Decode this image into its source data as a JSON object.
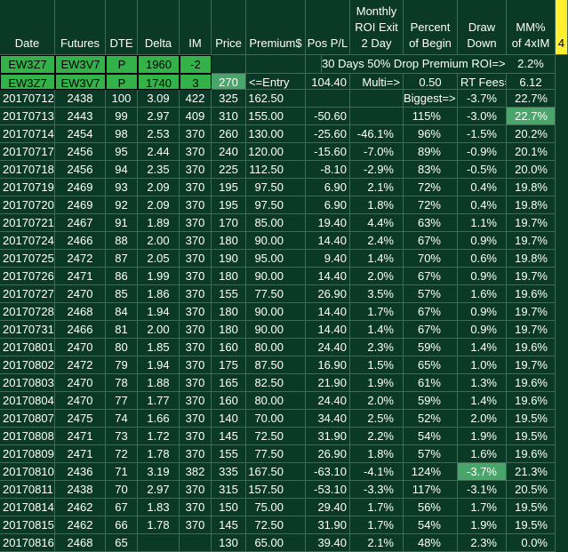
{
  "sheet": {
    "headers": {
      "date": "Date",
      "futures": "Futures",
      "dte": "DTE",
      "delta": "Delta",
      "im": "IM",
      "price": "Price",
      "premium": "Premium$",
      "pospl": "Pos P/L",
      "roi_lines": [
        "Monthly",
        "ROI Exit",
        "2 Day"
      ],
      "pct_lines": [
        "Percent",
        "of Begin"
      ],
      "draw_lines": [
        "Draw",
        "Down"
      ],
      "mm_lines": [
        "MM%",
        "of 4xIM"
      ],
      "marker": "4"
    },
    "colors": {
      "background": "#0a3a26",
      "grid": "#3e6a56",
      "input_green": "#33b24a",
      "highlight": "#4aa56a",
      "marker_yellow": "#ffef2e"
    },
    "param_rows": [
      {
        "option": "EW3Z7",
        "futures": "EW3V7",
        "type": "P",
        "strike": "1960",
        "qty": "-2",
        "note": "30 Days 50% Drop Premium ROI=>",
        "value": "2.2%"
      },
      {
        "option": "EW3Z7",
        "futures": "EW3V7",
        "type": "P",
        "strike": "1740",
        "qty": "3",
        "price": "270",
        "entry": "<=Entry",
        "pospl": "104.40",
        "multi_label": "Multi=>",
        "multi_value": "0.50",
        "fees_label": "RT Fees=>",
        "fees_value": "6.12"
      }
    ],
    "rows": [
      {
        "date": "20170712",
        "futures": "2438",
        "dte": "100",
        "delta": "3.09",
        "im": "422",
        "price": "325",
        "premium": "162.50",
        "pospl": "",
        "roi": "",
        "pct": "Biggest=>",
        "draw": "-3.7%",
        "mm": "22.7%"
      },
      {
        "date": "20170713",
        "futures": "2443",
        "dte": "99",
        "delta": "2.97",
        "im": "409",
        "price": "310",
        "premium": "155.00",
        "pospl": "-50.60",
        "roi": "",
        "pct": "115%",
        "draw": "-3.0%",
        "mm": "22.7%",
        "mm_hl": true
      },
      {
        "date": "20170714",
        "futures": "2454",
        "dte": "98",
        "delta": "2.53",
        "im": "370",
        "price": "260",
        "premium": "130.00",
        "pospl": "-25.60",
        "roi": "-46.1%",
        "pct": "96%",
        "draw": "-1.5%",
        "mm": "20.2%"
      },
      {
        "date": "20170717",
        "futures": "2456",
        "dte": "95",
        "delta": "2.44",
        "im": "370",
        "price": "240",
        "premium": "120.00",
        "pospl": "-15.60",
        "roi": "-7.0%",
        "pct": "89%",
        "draw": "-0.9%",
        "mm": "20.1%"
      },
      {
        "date": "20170718",
        "futures": "2456",
        "dte": "94",
        "delta": "2.35",
        "im": "370",
        "price": "225",
        "premium": "112.50",
        "pospl": "-8.10",
        "roi": "-2.9%",
        "pct": "83%",
        "draw": "-0.5%",
        "mm": "20.0%"
      },
      {
        "date": "20170719",
        "futures": "2469",
        "dte": "93",
        "delta": "2.09",
        "im": "370",
        "price": "195",
        "premium": "97.50",
        "pospl": "6.90",
        "roi": "2.1%",
        "pct": "72%",
        "draw": "0.4%",
        "mm": "19.8%"
      },
      {
        "date": "20170720",
        "futures": "2469",
        "dte": "92",
        "delta": "2.09",
        "im": "370",
        "price": "195",
        "premium": "97.50",
        "pospl": "6.90",
        "roi": "1.8%",
        "pct": "72%",
        "draw": "0.4%",
        "mm": "19.8%"
      },
      {
        "date": "20170721",
        "futures": "2467",
        "dte": "91",
        "delta": "1.89",
        "im": "370",
        "price": "170",
        "premium": "85.00",
        "pospl": "19.40",
        "roi": "4.4%",
        "pct": "63%",
        "draw": "1.1%",
        "mm": "19.7%"
      },
      {
        "date": "20170724",
        "futures": "2466",
        "dte": "88",
        "delta": "2.00",
        "im": "370",
        "price": "180",
        "premium": "90.00",
        "pospl": "14.40",
        "roi": "2.4%",
        "pct": "67%",
        "draw": "0.9%",
        "mm": "19.7%"
      },
      {
        "date": "20170725",
        "futures": "2472",
        "dte": "87",
        "delta": "2.05",
        "im": "370",
        "price": "190",
        "premium": "95.00",
        "pospl": "9.40",
        "roi": "1.4%",
        "pct": "70%",
        "draw": "0.6%",
        "mm": "19.8%"
      },
      {
        "date": "20170726",
        "futures": "2471",
        "dte": "86",
        "delta": "1.99",
        "im": "370",
        "price": "180",
        "premium": "90.00",
        "pospl": "14.40",
        "roi": "2.0%",
        "pct": "67%",
        "draw": "0.9%",
        "mm": "19.7%"
      },
      {
        "date": "20170727",
        "futures": "2470",
        "dte": "85",
        "delta": "1.86",
        "im": "370",
        "price": "155",
        "premium": "77.50",
        "pospl": "26.90",
        "roi": "3.5%",
        "pct": "57%",
        "draw": "1.6%",
        "mm": "19.6%"
      },
      {
        "date": "20170728",
        "futures": "2468",
        "dte": "84",
        "delta": "1.94",
        "im": "370",
        "price": "180",
        "premium": "90.00",
        "pospl": "14.40",
        "roi": "1.7%",
        "pct": "67%",
        "draw": "0.9%",
        "mm": "19.7%"
      },
      {
        "date": "20170731",
        "futures": "2466",
        "dte": "81",
        "delta": "2.00",
        "im": "370",
        "price": "180",
        "premium": "90.00",
        "pospl": "14.40",
        "roi": "1.4%",
        "pct": "67%",
        "draw": "0.9%",
        "mm": "19.7%"
      },
      {
        "date": "20170801",
        "futures": "2470",
        "dte": "80",
        "delta": "1.85",
        "im": "370",
        "price": "160",
        "premium": "80.00",
        "pospl": "24.40",
        "roi": "2.3%",
        "pct": "59%",
        "draw": "1.4%",
        "mm": "19.6%"
      },
      {
        "date": "20170802",
        "futures": "2472",
        "dte": "79",
        "delta": "1.94",
        "im": "370",
        "price": "175",
        "premium": "87.50",
        "pospl": "16.90",
        "roi": "1.5%",
        "pct": "65%",
        "draw": "1.0%",
        "mm": "19.7%"
      },
      {
        "date": "20170803",
        "futures": "2470",
        "dte": "78",
        "delta": "1.88",
        "im": "370",
        "price": "165",
        "premium": "82.50",
        "pospl": "21.90",
        "roi": "1.9%",
        "pct": "61%",
        "draw": "1.3%",
        "mm": "19.6%"
      },
      {
        "date": "20170804",
        "futures": "2470",
        "dte": "77",
        "delta": "1.77",
        "im": "370",
        "price": "160",
        "premium": "80.00",
        "pospl": "24.40",
        "roi": "2.0%",
        "pct": "59%",
        "draw": "1.4%",
        "mm": "19.6%"
      },
      {
        "date": "20170807",
        "futures": "2475",
        "dte": "74",
        "delta": "1.66",
        "im": "370",
        "price": "140",
        "premium": "70.00",
        "pospl": "34.40",
        "roi": "2.5%",
        "pct": "52%",
        "draw": "2.0%",
        "mm": "19.5%"
      },
      {
        "date": "20170808",
        "futures": "2471",
        "dte": "73",
        "delta": "1.72",
        "im": "370",
        "price": "145",
        "premium": "72.50",
        "pospl": "31.90",
        "roi": "2.2%",
        "pct": "54%",
        "draw": "1.9%",
        "mm": "19.5%"
      },
      {
        "date": "20170809",
        "futures": "2471",
        "dte": "72",
        "delta": "1.78",
        "im": "370",
        "price": "155",
        "premium": "77.50",
        "pospl": "26.90",
        "roi": "1.8%",
        "pct": "57%",
        "draw": "1.6%",
        "mm": "19.6%"
      },
      {
        "date": "20170810",
        "futures": "2436",
        "dte": "71",
        "delta": "3.19",
        "im": "382",
        "price": "335",
        "premium": "167.50",
        "pospl": "-63.10",
        "roi": "-4.1%",
        "pct": "124%",
        "draw": "-3.7%",
        "mm": "21.3%",
        "draw_hl": true
      },
      {
        "date": "20170811",
        "futures": "2438",
        "dte": "70",
        "delta": "2.97",
        "im": "370",
        "price": "315",
        "premium": "157.50",
        "pospl": "-53.10",
        "roi": "-3.3%",
        "pct": "117%",
        "draw": "-3.1%",
        "mm": "20.5%"
      },
      {
        "date": "20170814",
        "futures": "2462",
        "dte": "67",
        "delta": "1.83",
        "im": "370",
        "price": "150",
        "premium": "75.00",
        "pospl": "29.40",
        "roi": "1.7%",
        "pct": "56%",
        "draw": "1.7%",
        "mm": "19.5%"
      },
      {
        "date": "20170815",
        "futures": "2462",
        "dte": "66",
        "delta": "1.78",
        "im": "370",
        "price": "145",
        "premium": "72.50",
        "pospl": "31.90",
        "roi": "1.7%",
        "pct": "54%",
        "draw": "1.9%",
        "mm": "19.5%"
      },
      {
        "date": "20170816",
        "futures": "2468",
        "dte": "65",
        "delta": "",
        "im": "",
        "price": "130",
        "premium": "65.00",
        "pospl": "39.40",
        "roi": "2.1%",
        "pct": "48%",
        "draw": "2.3%",
        "mm": "0.0%"
      }
    ]
  }
}
